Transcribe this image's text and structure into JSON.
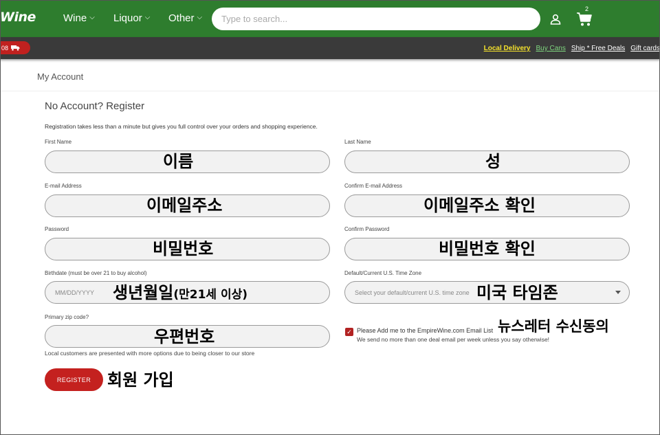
{
  "header": {
    "logo": "Wine",
    "nav": [
      {
        "label": "Wine"
      },
      {
        "label": "Liquor"
      },
      {
        "label": "Other"
      }
    ],
    "search_placeholder": "Type to search...",
    "cart_count": "2",
    "bg_color": "#2e7d2e"
  },
  "promo": {
    "pill_text": "08",
    "links": [
      "Local Delivery",
      "Buy Cans",
      "Ship * Free Deals",
      "Gift cards"
    ]
  },
  "account": {
    "title": "My Account"
  },
  "form": {
    "title": "No Account? Register",
    "intro": "Registration takes less than a minute but gives you full control over your orders and shopping experience.",
    "first_name": {
      "label": "First Name",
      "annotation": "이름"
    },
    "last_name": {
      "label": "Last Name",
      "annotation": "성"
    },
    "email": {
      "label": "E-mail Address",
      "annotation": "이메일주소"
    },
    "confirm_email": {
      "label": "Confirm E-mail Address",
      "annotation": "이메일주소 확인"
    },
    "password": {
      "label": "Password",
      "annotation": "비밀번호"
    },
    "confirm_password": {
      "label": "Confirm Password",
      "annotation": "비밀번호 확인"
    },
    "birthdate": {
      "label": "Birthdate (must be over 21 to buy alcohol)",
      "placeholder": "MM/DD/YYYY",
      "annotation": "생년월일",
      "annotation_small": "(만21세 이상)"
    },
    "timezone": {
      "label": "Default/Current U.S. Time Zone",
      "placeholder": "Select your default/current U.S. time zone",
      "annotation": "미국 타임존"
    },
    "zip": {
      "label": "Primary zip code?",
      "annotation": "우편번호",
      "hint": "Local customers are presented with more options due to being closer to our store"
    },
    "newsletter": {
      "label": "Please Add me to the EmpireWine.com Email List",
      "sub": "We send no more than one deal email per week unless you say otherwise!",
      "checked": true,
      "annotation": "뉴스레터 수신동의"
    },
    "register_button": "REGISTER",
    "register_annotation": "회원 가입",
    "accent_color": "#c4211f"
  }
}
